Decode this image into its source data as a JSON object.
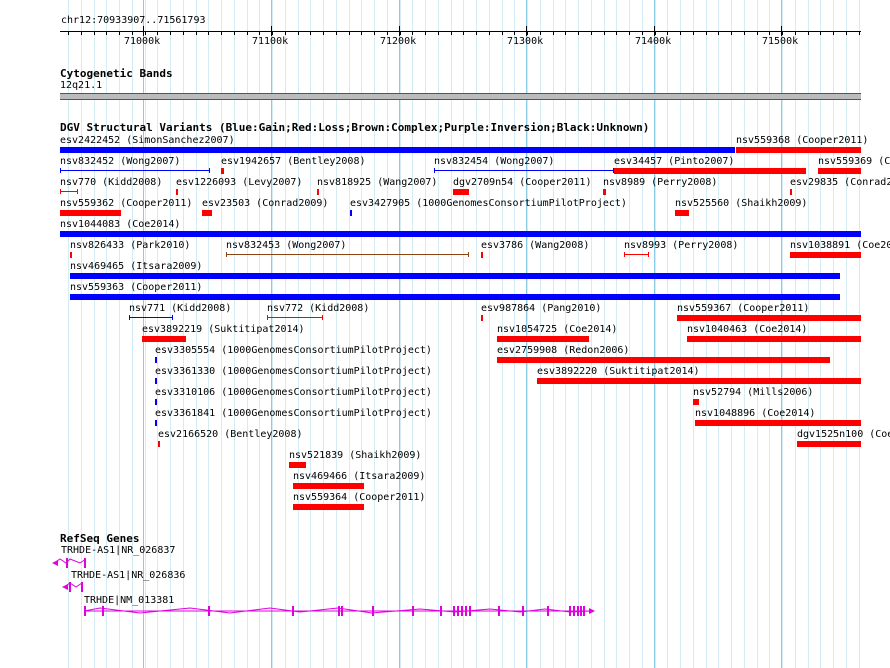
{
  "ruler": {
    "location": "chr12:70933907..71561793",
    "ticks": [
      "71000k",
      "71100k",
      "71200k",
      "71300k",
      "71400k",
      "71500k"
    ]
  },
  "cytoband": {
    "title": "Cytogenetic Bands",
    "label": "12q21.1"
  },
  "dgv": {
    "title": "DGV Structural Variants (Blue:Gain;Red:Loss;Brown:Complex;Purple:Inversion;Black:Unknown)",
    "colors": {
      "gain": "#0000ff",
      "loss": "#ff0000",
      "complex": "#8b4513"
    },
    "variants": [
      {
        "label": "esv2422452 (SimonSanchez2007)",
        "type": "gain"
      },
      {
        "label": "nsv559368 (Cooper2011)",
        "type": "loss"
      },
      {
        "label": "nsv832452 (Wong2007)",
        "type": "gain"
      },
      {
        "label": "esv1942657 (Bentley2008)",
        "type": "loss"
      },
      {
        "label": "nsv832454 (Wong2007)",
        "type": "gain"
      },
      {
        "label": "esv34457 (Pinto2007)",
        "type": "loss"
      },
      {
        "label": "nsv559369 (Co",
        "type": "loss"
      },
      {
        "label": "nsv770 (Kidd2008)",
        "type": "loss"
      },
      {
        "label": "esv1226093 (Levy2007)",
        "type": "loss"
      },
      {
        "label": "nsv818925 (Wang2007)",
        "type": "loss"
      },
      {
        "label": "dgv2709n54 (Cooper2011)",
        "type": "loss"
      },
      {
        "label": "nsv8989 (Perry2008)",
        "type": "loss"
      },
      {
        "label": "esv29835 (Conrad2",
        "type": "loss"
      },
      {
        "label": "nsv559362 (Cooper2011)",
        "type": "loss"
      },
      {
        "label": "esv23503 (Conrad2009)",
        "type": "loss"
      },
      {
        "label": "esv3427905 (1000GenomesConsortiumPilotProject)",
        "type": "gain"
      },
      {
        "label": "nsv525560 (Shaikh2009)",
        "type": "loss"
      },
      {
        "label": "nsv1044083 (Coe2014)",
        "type": "gain"
      },
      {
        "label": "nsv826433 (Park2010)",
        "type": "loss"
      },
      {
        "label": "nsv832453 (Wong2007)",
        "type": "complex"
      },
      {
        "label": "esv3786 (Wang2008)",
        "type": "loss"
      },
      {
        "label": "nsv8993 (Perry2008)",
        "type": "loss"
      },
      {
        "label": "nsv1038891 (Coe20",
        "type": "loss"
      },
      {
        "label": "nsv469465 (Itsara2009)",
        "type": "gain"
      },
      {
        "label": "nsv559363 (Cooper2011)",
        "type": "gain"
      },
      {
        "label": "nsv771 (Kidd2008)",
        "type": "gain"
      },
      {
        "label": "nsv772 (Kidd2008)",
        "type": "loss"
      },
      {
        "label": "esv987864 (Pang2010)",
        "type": "loss"
      },
      {
        "label": "nsv559367 (Cooper2011)",
        "type": "loss"
      },
      {
        "label": "esv3892219 (Suktitipat2014)",
        "type": "loss"
      },
      {
        "label": "nsv1054725 (Coe2014)",
        "type": "loss"
      },
      {
        "label": "nsv1040463 (Coe2014)",
        "type": "loss"
      },
      {
        "label": "esv3305554 (1000GenomesConsortiumPilotProject)",
        "type": "gain"
      },
      {
        "label": "esv2759908 (Redon2006)",
        "type": "loss"
      },
      {
        "label": "esv3361330 (1000GenomesConsortiumPilotProject)",
        "type": "gain"
      },
      {
        "label": "esv3892220 (Suktitipat2014)",
        "type": "loss"
      },
      {
        "label": "esv3310106 (1000GenomesConsortiumPilotProject)",
        "type": "gain"
      },
      {
        "label": "nsv52794 (Mills2006)",
        "type": "loss"
      },
      {
        "label": "esv3361841 (1000GenomesConsortiumPilotProject)",
        "type": "gain"
      },
      {
        "label": "nsv1048896 (Coe2014)",
        "type": "loss"
      },
      {
        "label": "esv2166520 (Bentley2008)",
        "type": "loss"
      },
      {
        "label": "dgv1525n100 (Coe",
        "type": "loss"
      },
      {
        "label": "nsv521839 (Shaikh2009)",
        "type": "loss"
      },
      {
        "label": "nsv469466 (Itsara2009)",
        "type": "loss"
      },
      {
        "label": "nsv559364 (Cooper2011)",
        "type": "loss"
      }
    ]
  },
  "refseq": {
    "title": "RefSeq Genes",
    "color": "#e000e0",
    "genes": [
      {
        "label": "TRHDE-AS1|NR_026837"
      },
      {
        "label": "TRHDE-AS1|NR_026836"
      },
      {
        "label": "TRHDE|NM_013381"
      }
    ]
  }
}
